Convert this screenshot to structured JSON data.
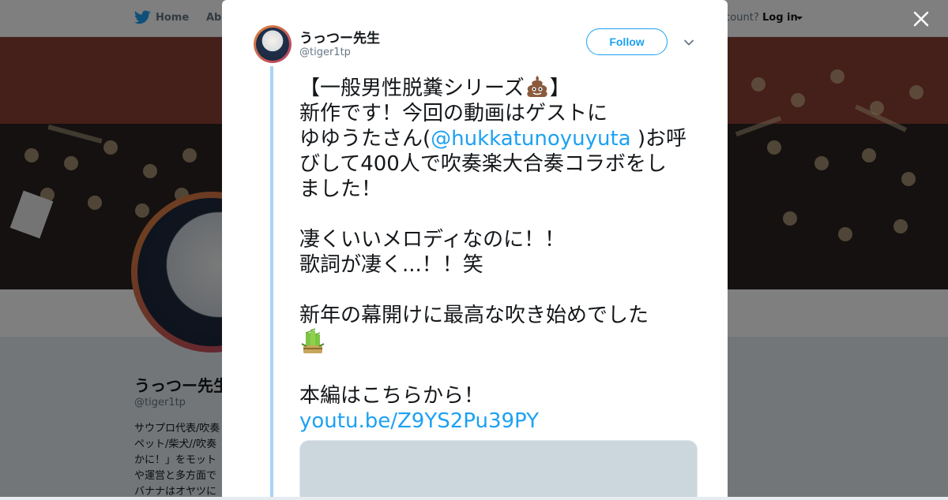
{
  "topbar": {
    "home_label": "Home",
    "about_label": "Abo",
    "account_text": "ccount?",
    "login_label": "Log in"
  },
  "profile": {
    "name": "うっつー先生",
    "handle": "@tiger1tp",
    "bio": "サウプロ代表/吹奏\nペット/柴犬//吹奏\nかに！」をモット\nや運営と多方面で\nバナナはオヤツに"
  },
  "tweet": {
    "author_name": "うっつー先生",
    "author_handle": "@tiger1tp",
    "follow_label": "Follow",
    "line1": "【一般男性脱糞シリーズ",
    "line1_end": "】",
    "line2": "新作です！今回の動画はゲストに",
    "line3_pre": "ゆゆうたさん(",
    "mention": "@hukkatunoyuyuta",
    "line3_post": " )お呼",
    "line4": "びして400人で吹奏楽大合奏コラボをし",
    "line5": "ました！",
    "line6": "凄くいいメロディなのに！！",
    "line7": "歌詞が凄く...！！笑",
    "line8": "新年の幕開けに最高な吹き始めでした",
    "line9": "本編はこちらから！",
    "link": "youtu.be/Z9YS2Pu39PY"
  },
  "icons": {
    "bird": "twitter-bird-icon",
    "close": "close-icon",
    "chevron": "chevron-down-icon",
    "poop": "pile-of-poo-emoji",
    "kadomatsu": "kadomatsu-emoji"
  },
  "colors": {
    "accent": "#1da1f2",
    "thread": "#aad3f4",
    "text": "#14171a",
    "muted": "#657786"
  }
}
